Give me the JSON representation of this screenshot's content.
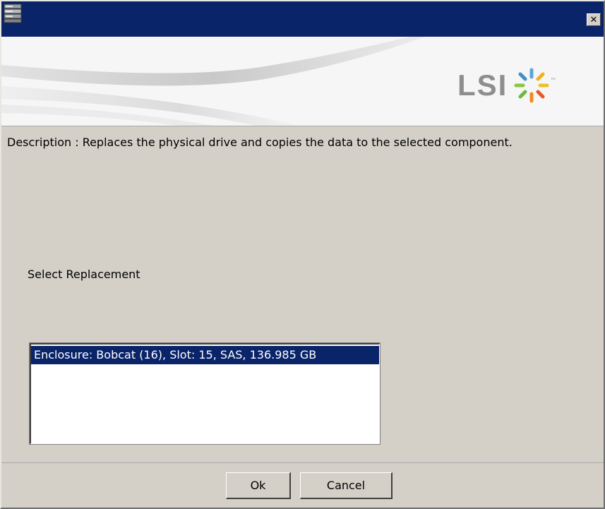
{
  "window": {
    "title": "",
    "close_glyph": "✕",
    "icons": {
      "app": "server-stack-icon",
      "close": "close-icon"
    }
  },
  "banner": {
    "logo_text": "LSI",
    "logo_mark": "lsi-starburst-logo",
    "trademark": "™"
  },
  "content": {
    "description": "Description : Replaces the physical drive and copies the data to the selected component.",
    "select_label": "Select Replacement",
    "list_items": [
      {
        "label": "Enclosure: Bobcat (16), Slot: 15, SAS, 136.985 GB",
        "selected": true
      }
    ]
  },
  "buttons": {
    "ok_label": "Ok",
    "cancel_label": "Cancel"
  },
  "colors": {
    "titlebar": "#0a246a",
    "selection": "#0a246a",
    "dialog_face": "#d4d0c8",
    "logo_text": "#8e8e8e"
  }
}
